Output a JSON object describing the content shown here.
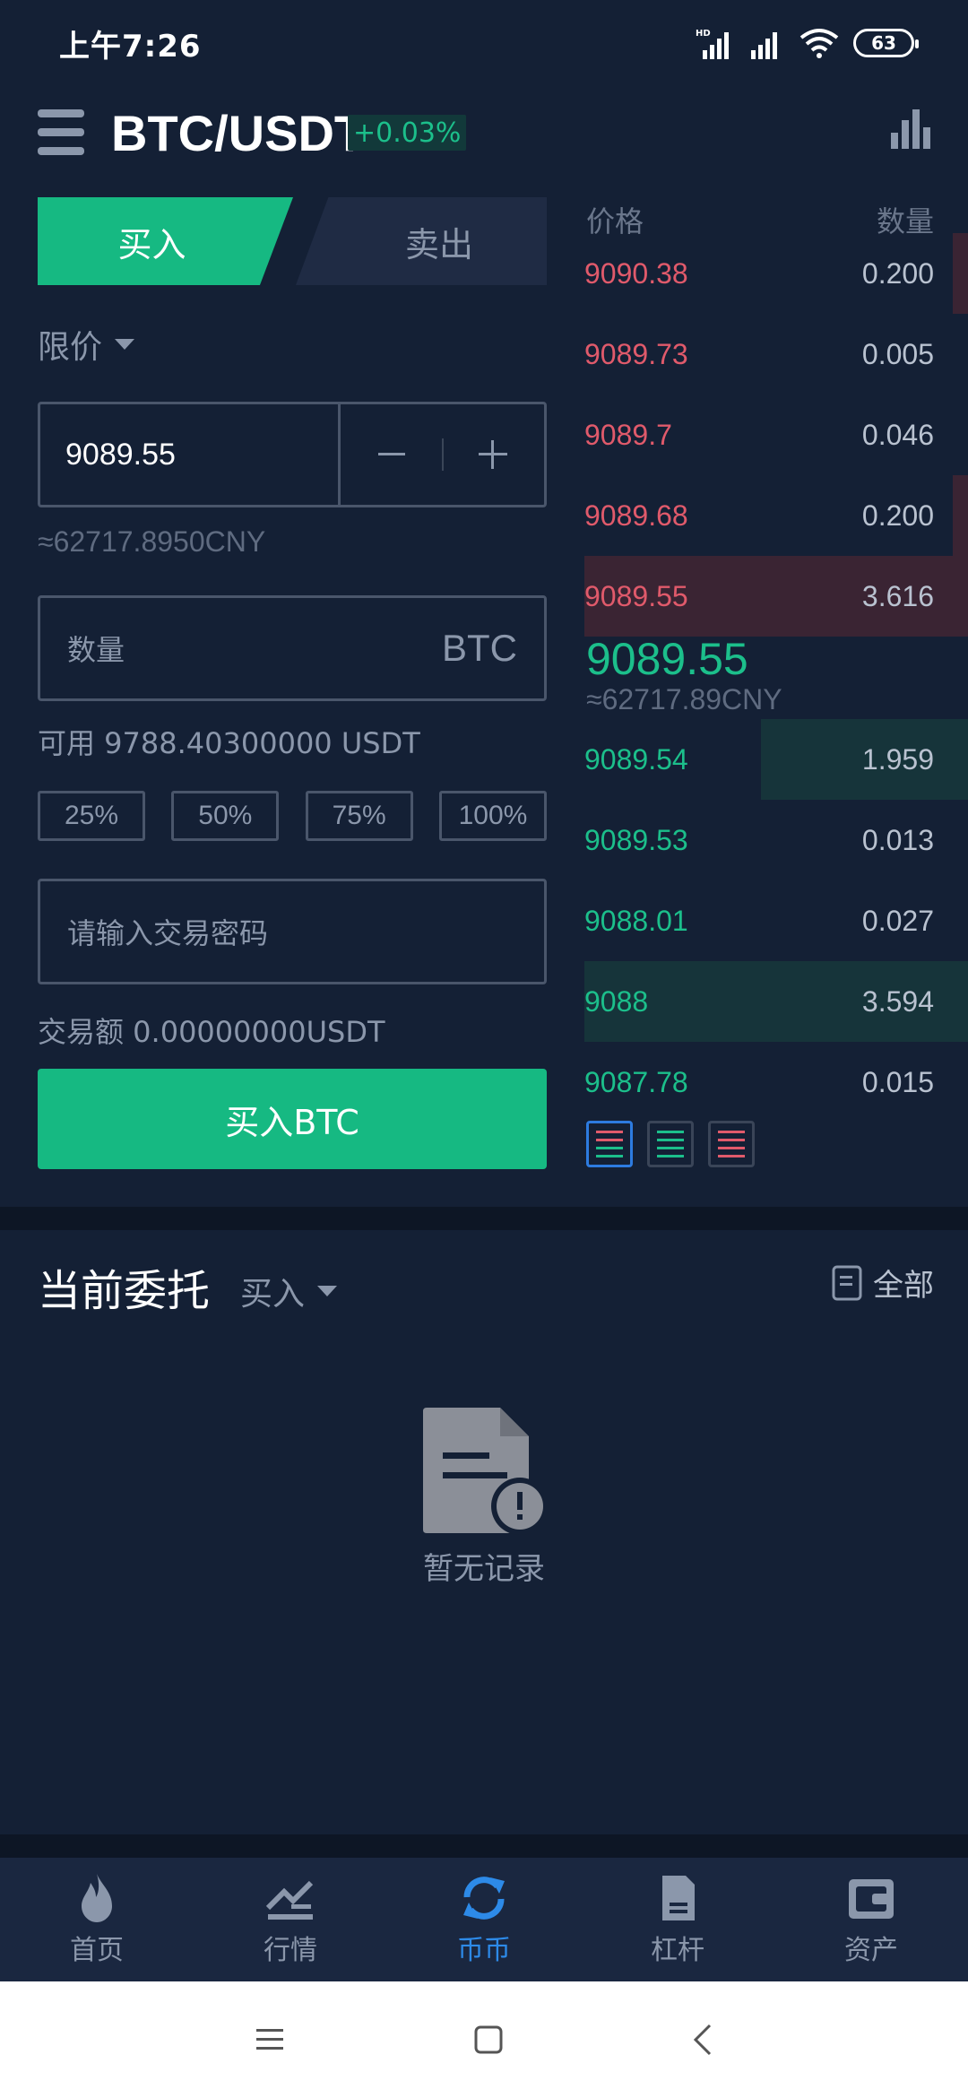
{
  "status_bar": {
    "time": "上午7:26",
    "battery": "63"
  },
  "header": {
    "pair": "BTC/USDT",
    "change": "+0.03%"
  },
  "trade_form": {
    "tab_buy": "买入",
    "tab_sell": "卖出",
    "order_type": "限价",
    "price_value": "9089.55",
    "price_cny": "≈62717.8950CNY",
    "quantity_placeholder": "数量",
    "quantity_unit": "BTC",
    "available": "可用 9788.40300000 USDT",
    "percent_buttons": [
      "25%",
      "50%",
      "75%",
      "100%"
    ],
    "password_placeholder": "请输入交易密码",
    "trade_amount": "交易额  0.00000000USDT",
    "submit": "买入BTC"
  },
  "order_book": {
    "header_price": "价格",
    "header_qty": "数量",
    "asks": [
      {
        "price": "9090.38",
        "qty": "0.200",
        "depth": 0.04
      },
      {
        "price": "9089.73",
        "qty": "0.005",
        "depth": 0.0
      },
      {
        "price": "9089.7",
        "qty": "0.046",
        "depth": 0.0
      },
      {
        "price": "9089.68",
        "qty": "0.200",
        "depth": 0.04
      },
      {
        "price": "9089.55",
        "qty": "3.616",
        "depth": 1.0
      }
    ],
    "last_price": "9089.55",
    "last_price_cny": "≈62717.89CNY",
    "bids": [
      {
        "price": "9089.54",
        "qty": "1.959",
        "depth": 0.54
      },
      {
        "price": "9089.53",
        "qty": "0.013",
        "depth": 0.0
      },
      {
        "price": "9088.01",
        "qty": "0.027",
        "depth": 0.0
      },
      {
        "price": "9088",
        "qty": "3.594",
        "depth": 1.0
      },
      {
        "price": "9087.78",
        "qty": "0.015",
        "depth": 0.0
      }
    ]
  },
  "orders": {
    "title": "当前委托",
    "filter": "买入",
    "all_label": "全部",
    "empty_text": "暂无记录"
  },
  "bottom_nav": [
    {
      "label": "首页",
      "icon": "flame-icon",
      "active": false
    },
    {
      "label": "行情",
      "icon": "market-icon",
      "active": false
    },
    {
      "label": "币币",
      "icon": "exchange-icon",
      "active": true
    },
    {
      "label": "杠杆",
      "icon": "leverage-icon",
      "active": false
    },
    {
      "label": "资产",
      "icon": "wallet-icon",
      "active": false
    }
  ],
  "colors": {
    "accent_green": "#16b982",
    "ask_red": "#e05a6b",
    "active_blue": "#2d8ae8",
    "background": "#142035"
  }
}
